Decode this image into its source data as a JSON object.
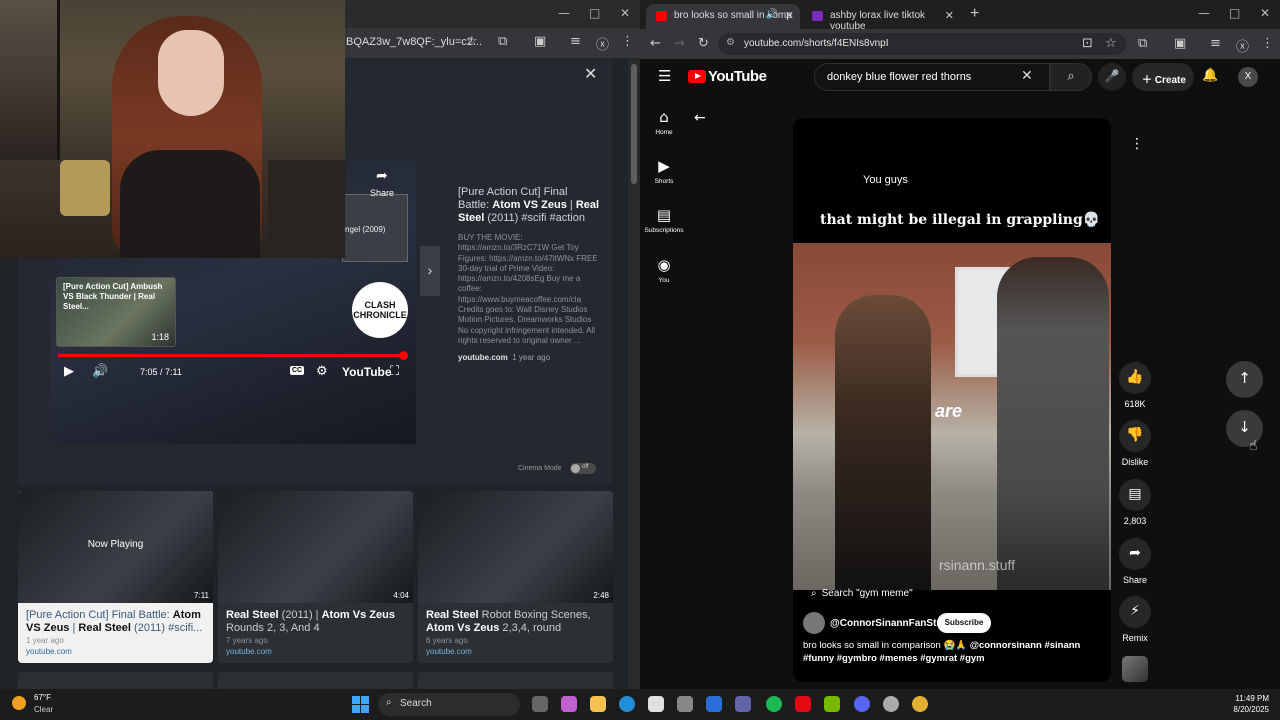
{
  "left_window": {
    "url_fragment": "BQAZ3w_7w8QF:_ylu=c2...",
    "video_modal": {
      "player": {
        "mini_thumb_title": "[Pure Action Cut] Ambush VS Black Thunder | Real Steel...",
        "mini_thumb_duration": "1:18",
        "right_thumb_text": "ngel (2009)",
        "share_label": "Share",
        "share_partial": "ter",
        "overlay_logo": "CLASH CHRONICLE",
        "time": "7:05 / 7:11",
        "progress": 0.986,
        "cc_label": "CC",
        "yt_label": "YouTube"
      },
      "title_prefix": "[Pure Action Cut] Final Battle: ",
      "title_bold1": "Atom VS Zeus",
      "title_sep": " | ",
      "title_bold2": "Real Steel",
      "title_suffix": " (2011) #scifi #action",
      "description": "BUY THE MOVIE: https://amzn.to/3RzC71W Get Toy Figures: https://amzn.to/47ltWNx FREE 30-day trial of Prime Video: https://amzn.to/4208sEg Buy me a coffee: https://www.buymeacoffee.com/cla Credits goes to: Walt Disney Studios Motion Pictures, Dreamworks Studios No copyright infringement intended. All rights reserved to original owner ...",
      "source": "youtube.com",
      "age": "1 year ago",
      "cinema_mode_label": "Cinema Mode",
      "cinema_mode_state": "off"
    },
    "related": [
      {
        "now_playing": "Now Playing",
        "duration": "7:11",
        "title_pre": "[Pure Action Cut] Final Battle: ",
        "title_b1": "Atom VS Zeus",
        "title_mid": " | ",
        "title_b2": "Real Steel",
        "title_post": " (2011) #scifi...",
        "age": "1 year ago",
        "source": "youtube.com"
      },
      {
        "duration": "4:04",
        "title_b1": "Real Steel",
        "title_mid": " (2011) | ",
        "title_b2": "Atom Vs Zeus",
        "title_post": " Rounds 2, 3, And 4",
        "age": "7 years ago",
        "source": "youtube.com"
      },
      {
        "duration": "2:48",
        "title_b1": "Real Steel",
        "title_mid": " Robot Boxing Scenes, ",
        "title_b2": "Atom Vs Zeus",
        "title_post": " 2,3,4, round",
        "age": "6 years ago",
        "source": "youtube.com"
      }
    ]
  },
  "right_window": {
    "tabs": [
      {
        "label": "bro looks so small in comp",
        "favicon_color": "#ff0000"
      },
      {
        "label": "ashby lorax live tiktok youtube",
        "favicon_color": "#7b2cbf"
      }
    ],
    "url": "youtube.com/shorts/f4ENIs8vnpI",
    "youtube": {
      "logo_text": "YouTube",
      "search_value": "donkey blue flower red thorns",
      "create_label": "Create",
      "avatar_letter": "X",
      "guide": [
        {
          "label": "Home",
          "icon": "home-icon"
        },
        {
          "label": "Shorts",
          "icon": "shorts-icon"
        },
        {
          "label": "Subscriptions",
          "icon": "subscriptions-icon"
        },
        {
          "label": "You",
          "icon": "you-icon"
        }
      ]
    },
    "short": {
      "caption_line1": "You guys",
      "caption_line2": "that might be illegal in grappling💀",
      "word_overlay": "are",
      "watermark": "rsinann.stuff",
      "search_chip": "Search \"gym meme\"",
      "channel": "@ConnorSinannFanStuff",
      "subscribe_label": "Subscribe",
      "description_pre": "bro looks so small in comparison 😭🙏 ",
      "description_bold": "@connorsinann #sinann #funny #gymbro #memes #gymrat #gym"
    },
    "actions": {
      "like_count": "618K",
      "dislike_label": "Dislike",
      "comment_count": "2,803",
      "share_label": "Share",
      "remix_label": "Remix"
    }
  },
  "taskbar": {
    "temperature": "67°F",
    "condition": "Clear",
    "search_label": "Search",
    "time": "11:49 PM",
    "date": "8/20/2025"
  }
}
